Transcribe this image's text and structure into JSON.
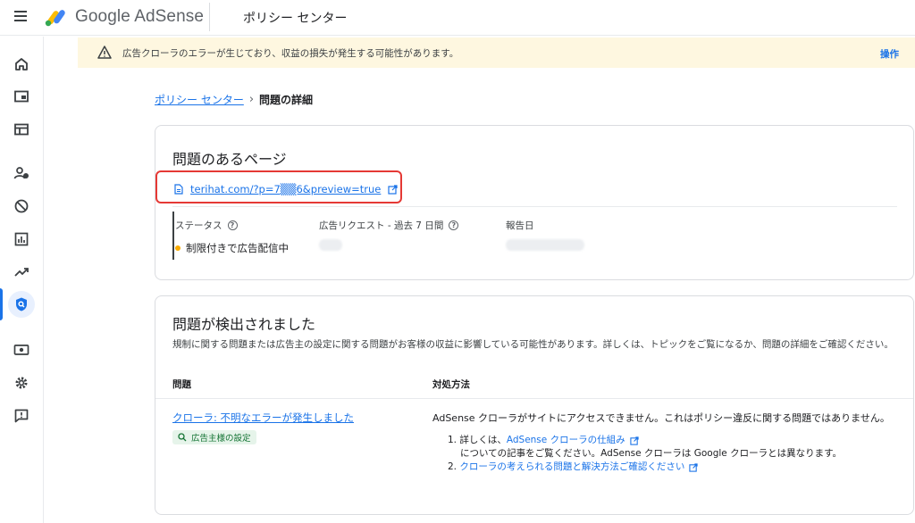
{
  "topbar": {
    "brand": "Google AdSense",
    "section_title": "ポリシー センター"
  },
  "banner": {
    "message": "広告クローラのエラーが生じており、収益の損失が発生する可能性があります。",
    "action": "操作",
    "background": "#fef7e0"
  },
  "breadcrumb": {
    "parent": "ポリシー センター",
    "current": "問題の詳細"
  },
  "page_card": {
    "title": "問題のあるページ",
    "url": "terihat.com/?p=7▒▒6&preview=true",
    "status_label": "ステータス",
    "status_value": "制限付きで広告配信中",
    "requests_label": "広告リクエスト - 過去 7 日間",
    "report_label": "報告日",
    "status_color": "#f9ab00"
  },
  "issues_card": {
    "title": "問題が検出されました",
    "description": "規制に関する問題または広告主の設定に関する問題がお客様の収益に影響している可能性があります。詳しくは、トピックをご覧になるか、問題の詳細をご確認ください。",
    "col_issue": "問題",
    "col_action": "対処方法",
    "issue_link": "クローラ: 不明なエラーが発生しました",
    "issue_chip": "広告主様の設定",
    "resolution": "AdSense クローラがサイトにアクセスできません。これはポリシー違反に関する問題ではありません。",
    "step1_prefix": "1. 詳しくは、",
    "step1_link": "AdSense クローラの仕組み",
    "step1_suffix": "についての記事をご覧ください。AdSense クローラは Google クローラとは異なります。",
    "step2_prefix": "2.",
    "step2_link": "クローラの考えられる問題と解決方法ご確認ください"
  },
  "rail_icons": [
    "home-icon",
    "ads-icon",
    "sites-icon",
    "privacy-icon",
    "blocking-icon",
    "reports-icon",
    "optimization-icon",
    "policy-center-icon",
    "payments-icon",
    "settings-icon",
    "feedback-icon"
  ],
  "accent_color": "#1a73e8"
}
